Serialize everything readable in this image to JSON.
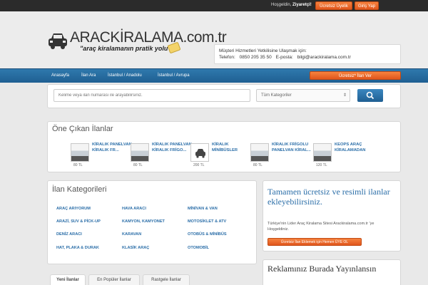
{
  "topbar": {
    "greeting": "Hoşgeldin,",
    "user": "Ziyaretçi!",
    "register": "Ücretsiz Üyelik",
    "login": "Giriş Yap"
  },
  "header": {
    "logo_text": "ARACKİRALAMA.com.tr",
    "tagline": "\"araç kiralamanın pratik yolu\"",
    "contact_title": "Müşteri Hizmetleri Yetkilisine Ulaşmak için:",
    "phone_label": "Telefon:",
    "phone": "0850 205 35 50",
    "email_label": "E-posta:",
    "email": "bilgi@arackiralama.com.tr"
  },
  "nav": {
    "items": [
      "Anasayfa",
      "İlan Ara",
      "İstanbul / Anadolu",
      "İstanbul / Avrupa"
    ],
    "cta": "Ücretsiz* İlan Ver"
  },
  "search": {
    "placeholder": "Kelime veya ilan numarası ile arayabilirsiniz.",
    "category": "Tüm Kategoriler"
  },
  "featured": {
    "title": "Öne Çıkan İlanlar",
    "items": [
      {
        "name": "KİRALIK PANELVAN KİRALIK FR...",
        "price": "80 TL"
      },
      {
        "name": "KİRALIK PANELVAN KİRALIK FRİGO...",
        "price": "80 TL"
      },
      {
        "name": "KİRALIK MİNİBÜSLER",
        "price": "200 TL"
      },
      {
        "name": "KİRALIK FRİGOLU PANELVAN KİRAL...",
        "price": "80 TL"
      },
      {
        "name": "KEOPS ARAÇ KİRALAMADAN",
        "price": "120 TL"
      }
    ]
  },
  "categories": {
    "title": "İlan Kategorileri",
    "items": [
      "ARAÇ ARIYORUM",
      "HAVA ARACI",
      "MİNİVAN & VAN",
      "ARAZİ, SUV & PİCK-UP",
      "KAMYON, KAMYONET",
      "MOTOSİKLET & ATV",
      "DENİZ ARACI",
      "KARAVAN",
      "OTOBÜS & MİNİBÜS",
      "HAT, PLAKA & DURAK",
      "KLASİK ARAÇ",
      "OTOMOBİL"
    ]
  },
  "promo": {
    "headline": "Tamamen ücretsiz ve resimli ilanlar ekleyebilirsiniz.",
    "text": "Türkiye'nin Lider Araç Kiralama Sitesi Arackiralama.com.tr 'ye Hoşgeldiniz.",
    "button": "Ücretsiz İlan Eklemek için Hemen ÜYE OL"
  },
  "tabs": [
    "Yeni İlanlar",
    "En Popüler İlanlar",
    "Rastgele İlanlar"
  ],
  "ads": {
    "headline": "Reklamınız Burada Yayınlansın"
  }
}
